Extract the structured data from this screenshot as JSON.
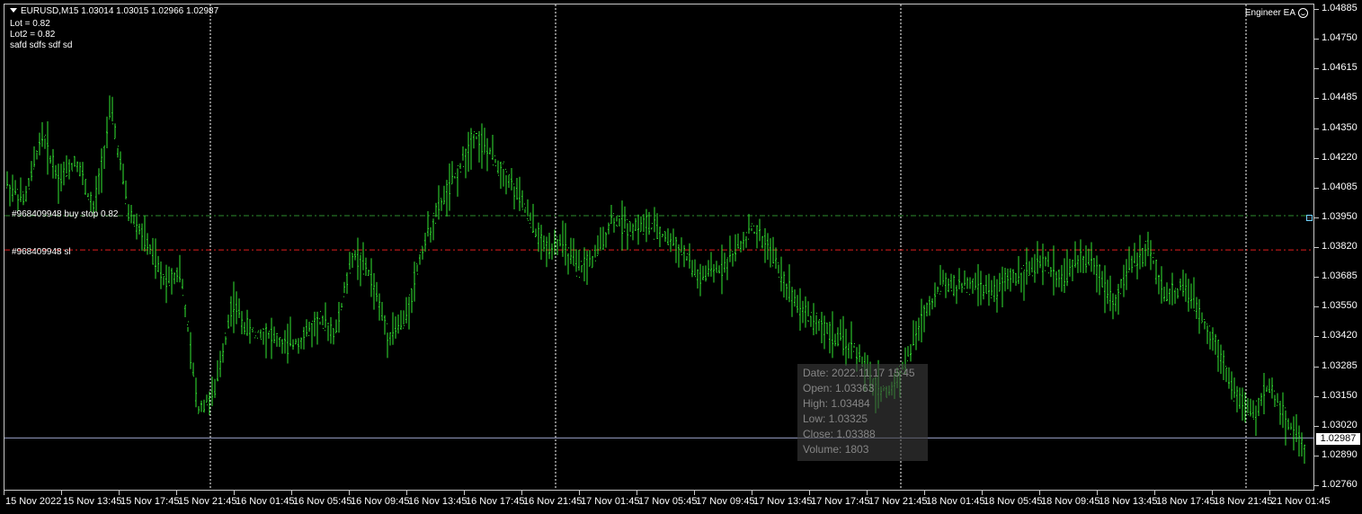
{
  "header": {
    "symbol_line": "EURUSD,M15  1.03014 1.03015 1.02966 1.02987",
    "lot": "Lot = 0.82",
    "lot2": "Lot2 = 0.82",
    "notes": "safd    sdfs sdf  sd",
    "ea_name": "Engineer EA"
  },
  "orders": {
    "buy_stop_label": "#968409948 buy stop 0.82",
    "sl_label": "#968409948 sl",
    "buy_stop_price": 1.0396,
    "sl_price": 1.0381
  },
  "price_scale": {
    "labels": [
      "1.04885",
      "1.04750",
      "1.04615",
      "1.04485",
      "1.04350",
      "1.04220",
      "1.04085",
      "1.03950",
      "1.03820",
      "1.03685",
      "1.03550",
      "1.03420",
      "1.03285",
      "1.03150",
      "1.03020",
      "1.02890",
      "1.02760"
    ],
    "current_price": "1.02987"
  },
  "time_scale": {
    "labels": [
      "15 Nov 2022",
      "15 Nov 13:45",
      "15 Nov 17:45",
      "15 Nov 21:45",
      "16 Nov 01:45",
      "16 Nov 05:45",
      "16 Nov 09:45",
      "16 Nov 13:45",
      "16 Nov 17:45",
      "16 Nov 21:45",
      "17 Nov 01:45",
      "17 Nov 05:45",
      "17 Nov 09:45",
      "17 Nov 13:45",
      "17 Nov 17:45",
      "17 Nov 21:45",
      "18 Nov 01:45",
      "18 Nov 05:45",
      "18 Nov 09:45",
      "18 Nov 13:45",
      "18 Nov 17:45",
      "18 Nov 21:45",
      "21 Nov 01:45"
    ]
  },
  "tooltip": {
    "date": "Date: 2022.11.17  15:45",
    "open": "Open: 1.03363",
    "high": "High: 1.03484",
    "low": "Low:  1.03325",
    "close": "Close: 1.03388",
    "volume": "Volume: 1803"
  },
  "colors": {
    "candle": "#32e632",
    "background": "#000000",
    "buy_stop_line": "#2e8b2e",
    "sl_line": "#e01c1c",
    "grid_day": "#ffffff",
    "current_price_line": "#9aa0c8"
  },
  "chart_data": {
    "type": "line",
    "symbol": "EURUSD",
    "timeframe": "M15",
    "ylim": [
      1.0276,
      1.04885
    ],
    "x_labels": [
      "15 Nov 2022",
      "15 Nov 13:45",
      "15 Nov 17:45",
      "15 Nov 21:45",
      "16 Nov 01:45",
      "16 Nov 05:45",
      "16 Nov 09:45",
      "16 Nov 13:45",
      "16 Nov 17:45",
      "16 Nov 21:45",
      "17 Nov 01:45",
      "17 Nov 05:45",
      "17 Nov 09:45",
      "17 Nov 13:45",
      "17 Nov 17:45",
      "17 Nov 21:45",
      "18 Nov 01:45",
      "18 Nov 05:45",
      "18 Nov 09:45",
      "18 Nov 13:45",
      "18 Nov 17:45",
      "18 Nov 21:45",
      "21 Nov 01:45"
    ],
    "series": [
      {
        "values": [
          1.041,
          1.0402,
          1.0432,
          1.0412,
          1.0421,
          1.0398,
          1.0443,
          1.0398,
          1.0385,
          1.0368,
          1.0372,
          1.0312,
          1.0318,
          1.0358,
          1.0345,
          1.0345,
          1.0339,
          1.0342,
          1.035,
          1.0345,
          1.038,
          1.037,
          1.0344,
          1.035,
          1.0382,
          1.04,
          1.0414,
          1.0432,
          1.0422,
          1.0412,
          1.0398,
          1.0382,
          1.0385,
          1.0372,
          1.0378,
          1.0395,
          1.0391,
          1.0392,
          1.0387,
          1.0381,
          1.0368,
          1.0372,
          1.0379,
          1.039,
          1.0383,
          1.0366,
          1.0355,
          1.0348,
          1.0342,
          1.0338,
          1.0322,
          1.0318,
          1.0333,
          1.0353,
          1.0367,
          1.0365,
          1.0366,
          1.0362,
          1.0369,
          1.0372,
          1.0375,
          1.0368,
          1.0378,
          1.0373,
          1.0358,
          1.0375,
          1.0382,
          1.036,
          1.0365,
          1.0352,
          1.0338,
          1.0318,
          1.0308,
          1.0322,
          1.0306,
          1.0295
        ]
      }
    ]
  }
}
